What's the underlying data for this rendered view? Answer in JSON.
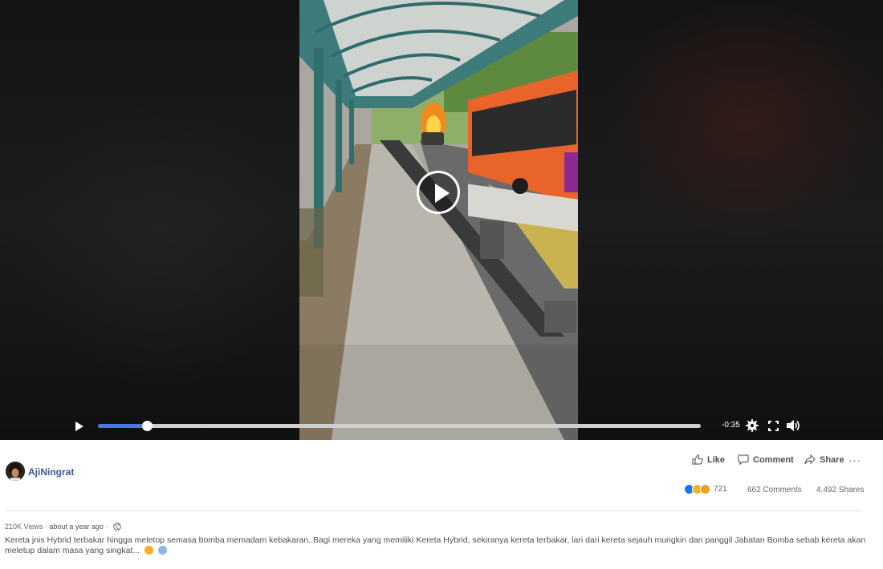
{
  "video": {
    "time_remaining": "-0:35",
    "progress_fraction": 0.081,
    "icons": {
      "play_overlay": "play-icon",
      "play": "play-icon",
      "settings": "gear-icon",
      "fullscreen": "fullscreen-icon",
      "volume": "volume-icon"
    }
  },
  "post": {
    "author": "AjiNingrat",
    "actions": {
      "like": "Like",
      "comment": "Comment",
      "share": "Share",
      "more": "···"
    },
    "reactions_count": "721",
    "comments": "662 Comments",
    "shares": "4,492 Shares",
    "views": "210K Views",
    "separator": " · ",
    "timestamp": "about a year ago",
    "description": "Kereta jnis Hybrid terbakar hingga meletop semasa bomba memadam kebakaran..Bagi mereka yang memiliki Kereta Hybrid, sekiranya kereta terbakar, lari dari kereta sejauh mungkin dan panggil Jabatan Bomba sebab kereta akan meletup dalam masa yang singkat..."
  },
  "colors": {
    "link": "#385898",
    "progress": "#4a76e8",
    "like_reaction": "#1877f2",
    "wow_reaction": "#f7b125"
  }
}
